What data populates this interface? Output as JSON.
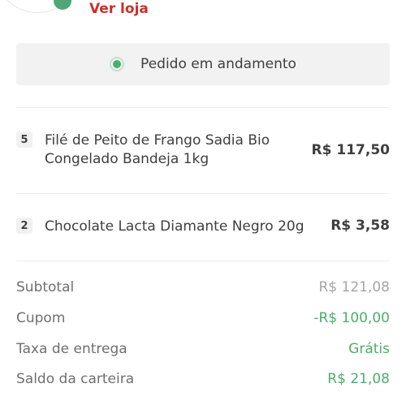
{
  "store": {
    "link_label": "Ver loja"
  },
  "status": {
    "label": "Pedido em andamento"
  },
  "items": [
    {
      "qty": "5",
      "name_line1": "Filé de Peito de Frango Sadia Bio",
      "name_line2": "Congelado Bandeja 1kg",
      "price": "R$ 117,50"
    },
    {
      "qty": "2",
      "name_line1": "Chocolate Lacta Diamante Negro 20g",
      "price": "R$ 3,58"
    }
  ],
  "summary": {
    "subtotal": {
      "label": "Subtotal",
      "value": "R$ 121,08"
    },
    "coupon": {
      "label": "Cupom",
      "value": "-R$ 100,00"
    },
    "delivery": {
      "label": "Taxa de entrega",
      "value": "Grátis"
    },
    "wallet": {
      "label": "Saldo da carteira",
      "value": "R$ 21,08"
    }
  },
  "colors": {
    "accent_red": "#c9302c",
    "accent_green": "#4ead6c",
    "status_bg": "#f2f2f2"
  }
}
